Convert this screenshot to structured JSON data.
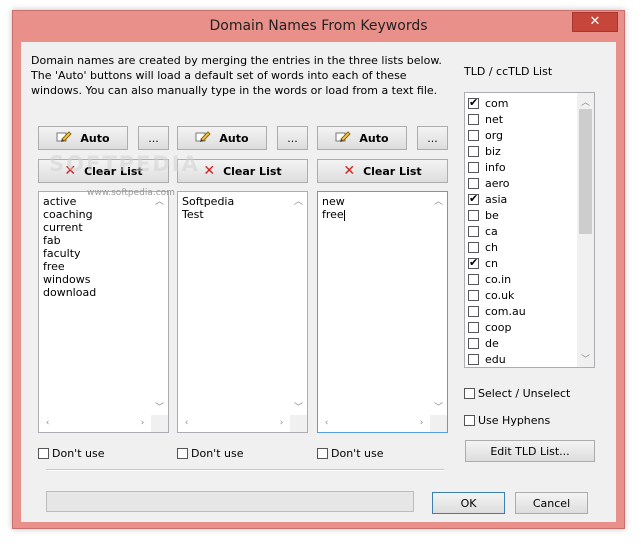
{
  "window": {
    "title": "Domain Names From Keywords",
    "close_label": "✕"
  },
  "description": "Domain names are created by merging the entries in the three lists below. The 'Auto' buttons will load a default set of words into each of these windows. You can also manually type in the words or load from a text file.",
  "watermark": {
    "brand": "SOFTPEDIA",
    "url": "www.softpedia.com"
  },
  "columns": [
    {
      "auto_label": "Auto",
      "more_label": "...",
      "clear_label": "Clear List",
      "lines": [
        "active",
        "coaching",
        "current",
        "fab",
        "faculty",
        "free",
        "windows",
        "download"
      ],
      "dont_use_label": "Don't use",
      "dont_use_checked": false
    },
    {
      "auto_label": "Auto",
      "more_label": "...",
      "clear_label": "Clear List",
      "lines": [
        "Softpedia",
        "Test"
      ],
      "dont_use_label": "Don't use",
      "dont_use_checked": false
    },
    {
      "auto_label": "Auto",
      "more_label": "...",
      "clear_label": "Clear List",
      "lines": [
        "new",
        "free"
      ],
      "dont_use_label": "Don't use",
      "dont_use_checked": false
    }
  ],
  "tld": {
    "label": "TLD / ccTLD List",
    "items": [
      {
        "name": "com",
        "checked": true
      },
      {
        "name": "net",
        "checked": false
      },
      {
        "name": "org",
        "checked": false
      },
      {
        "name": "biz",
        "checked": false
      },
      {
        "name": "info",
        "checked": false
      },
      {
        "name": "aero",
        "checked": false
      },
      {
        "name": "asia",
        "checked": true
      },
      {
        "name": "be",
        "checked": false
      },
      {
        "name": "ca",
        "checked": false
      },
      {
        "name": "ch",
        "checked": false
      },
      {
        "name": "cn",
        "checked": true
      },
      {
        "name": "co.in",
        "checked": false
      },
      {
        "name": "co.uk",
        "checked": false
      },
      {
        "name": "com.au",
        "checked": false
      },
      {
        "name": "coop",
        "checked": false
      },
      {
        "name": "de",
        "checked": false
      },
      {
        "name": "edu",
        "checked": false
      }
    ],
    "select_unselect_label": "Select / Unselect",
    "use_hyphens_label": "Use Hyphens",
    "edit_label": "Edit TLD List..."
  },
  "footer": {
    "ok_label": "OK",
    "cancel_label": "Cancel"
  },
  "colors": {
    "frame": "#e9908a",
    "close": "#c7463c",
    "focus": "#569de5"
  }
}
